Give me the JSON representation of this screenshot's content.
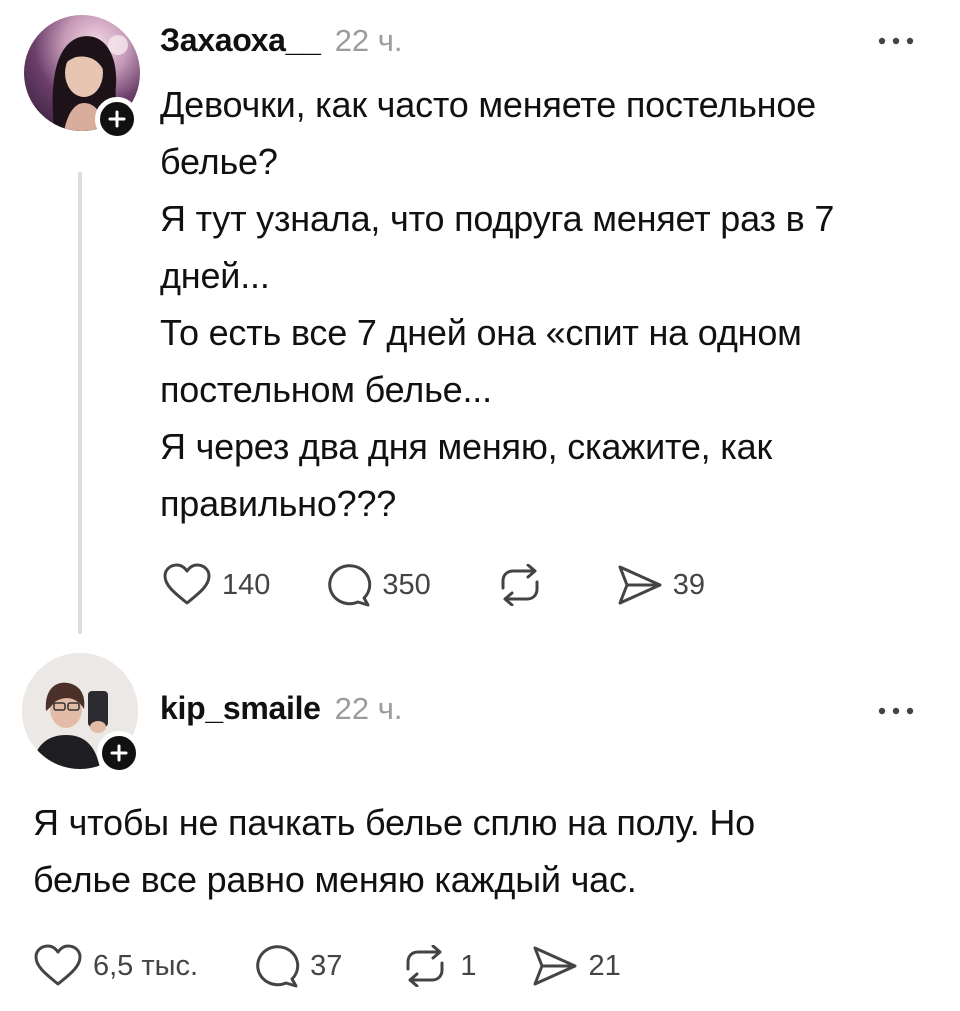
{
  "post1": {
    "username": "Захаоха__",
    "time": "22 ч.",
    "text": [
      "Девочки, как часто меняете постельное белье?",
      "Я тут узнала, что подруга меняет раз в 7 дней...",
      "То есть все 7 дней она «спит на одном постельном белье...",
      "Я через два дня меняю, скажите, как правильно???"
    ],
    "likes": "140",
    "replies": "350",
    "reposts": "",
    "shares": "39"
  },
  "post2": {
    "username": "kip_smaile",
    "time": "22 ч.",
    "text": [
      "Я чтобы не пачкать белье сплю на полу. Но белье все равно меняю каждый час."
    ],
    "likes": "6,5 тыс.",
    "replies": "37",
    "reposts": "1",
    "shares": "21"
  },
  "icons": {
    "like": "heart-icon",
    "reply": "speech-bubble-icon",
    "repost": "repost-arrows-icon",
    "share": "paper-plane-icon",
    "follow": "plus-icon",
    "more": "ellipsis-icon"
  },
  "colors": {
    "text": "#111111",
    "muted": "#9c9c9c",
    "icon": "#444444",
    "thread_line": "#dcdcdc"
  }
}
